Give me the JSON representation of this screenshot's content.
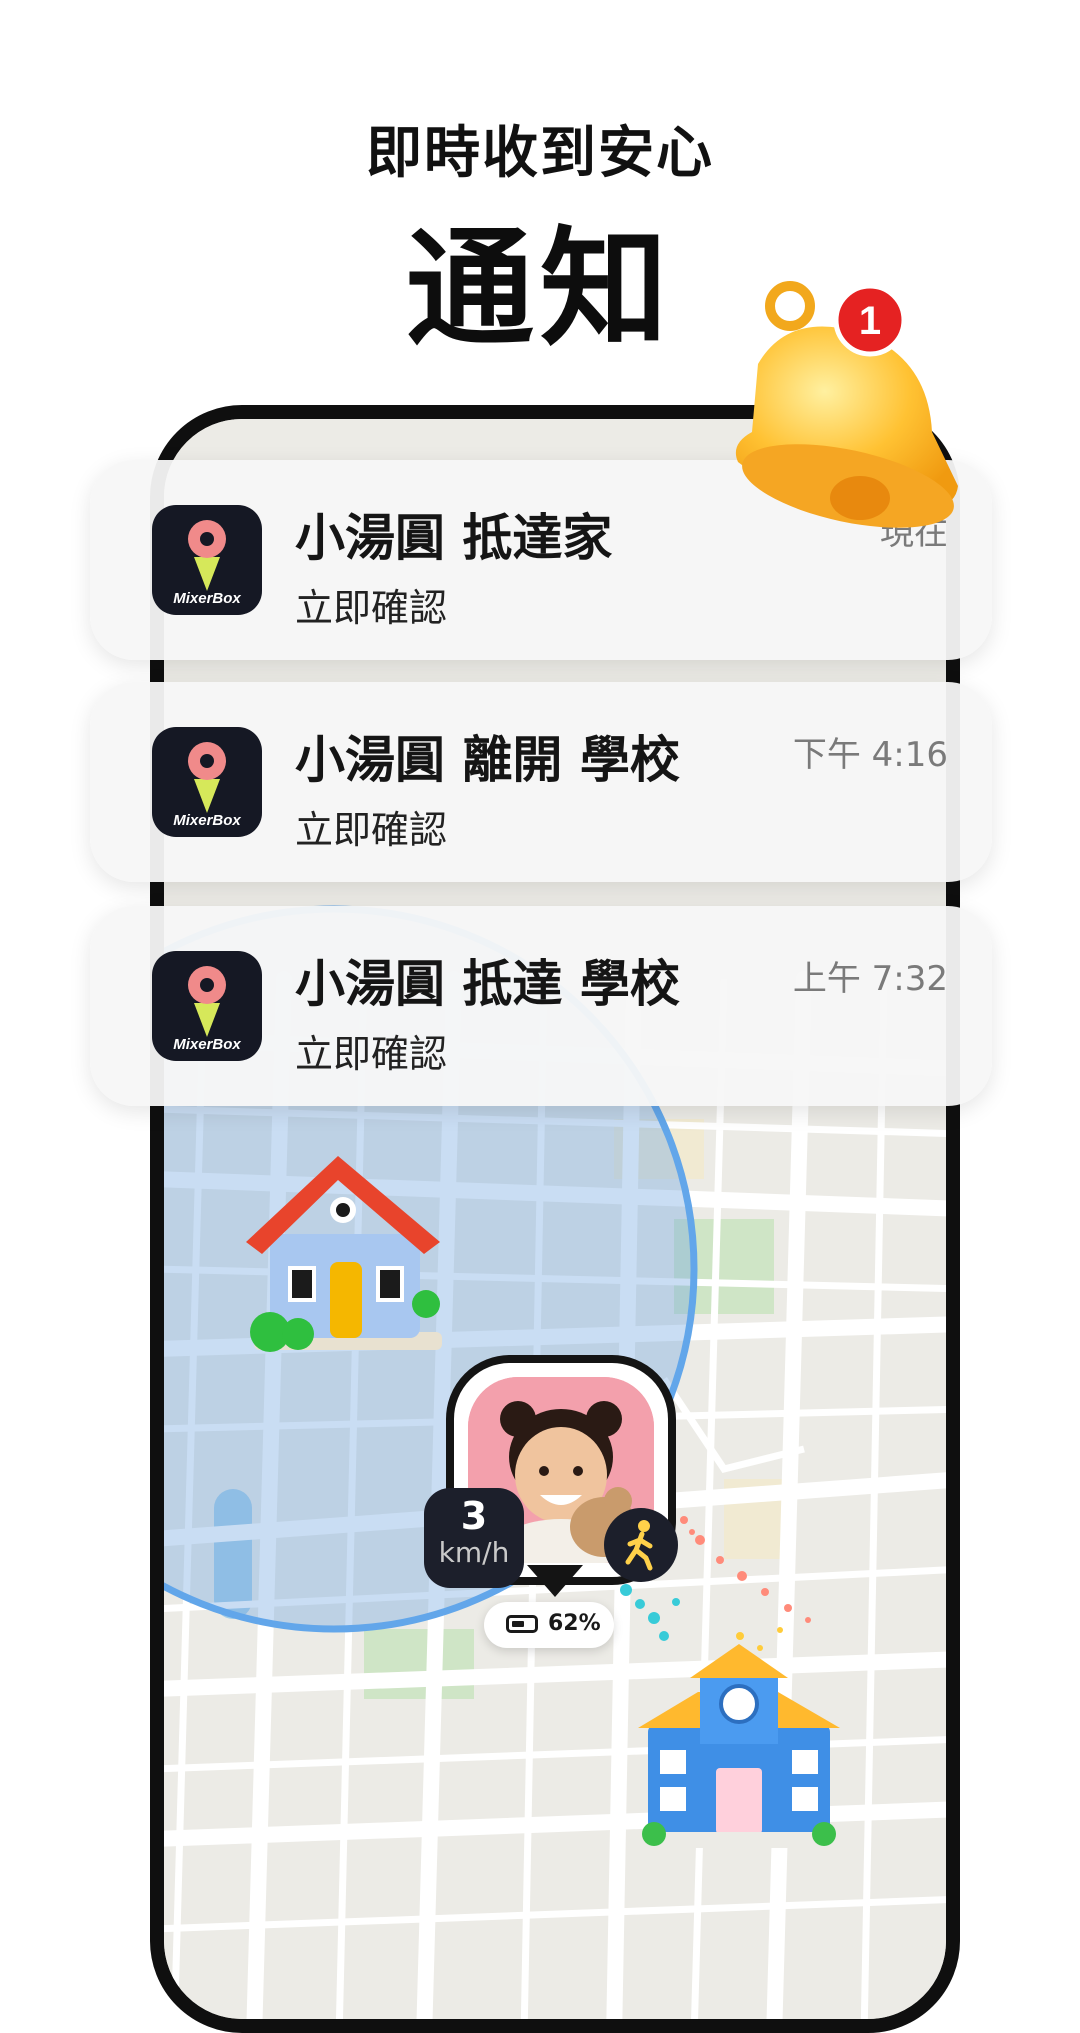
{
  "header": {
    "headline": "即時收到安心",
    "hero": "通知"
  },
  "bell": {
    "badge_count": "1"
  },
  "notifications": [
    {
      "app_name": "MixerBox",
      "title": "小湯圓 抵達家",
      "subtitle": "立即確認",
      "time": "現在"
    },
    {
      "app_name": "MixerBox",
      "title": "小湯圓 離開 學校",
      "subtitle": "立即確認",
      "time": "下午 4:16"
    },
    {
      "app_name": "MixerBox",
      "title": "小湯圓 抵達 學校",
      "subtitle": "立即確認",
      "time": "上午 7:32"
    }
  ],
  "tracker": {
    "speed_value": "3",
    "speed_unit": "km/h",
    "battery": "62%",
    "battery_level": 0.62
  },
  "colors": {
    "geofence": "#6aa8e6",
    "icon_bg": "#151824",
    "icon_pink": "#f08a8a",
    "icon_lime": "#d6e85a",
    "bell_yellow": "#ffc233",
    "badge_red": "#e52222"
  }
}
